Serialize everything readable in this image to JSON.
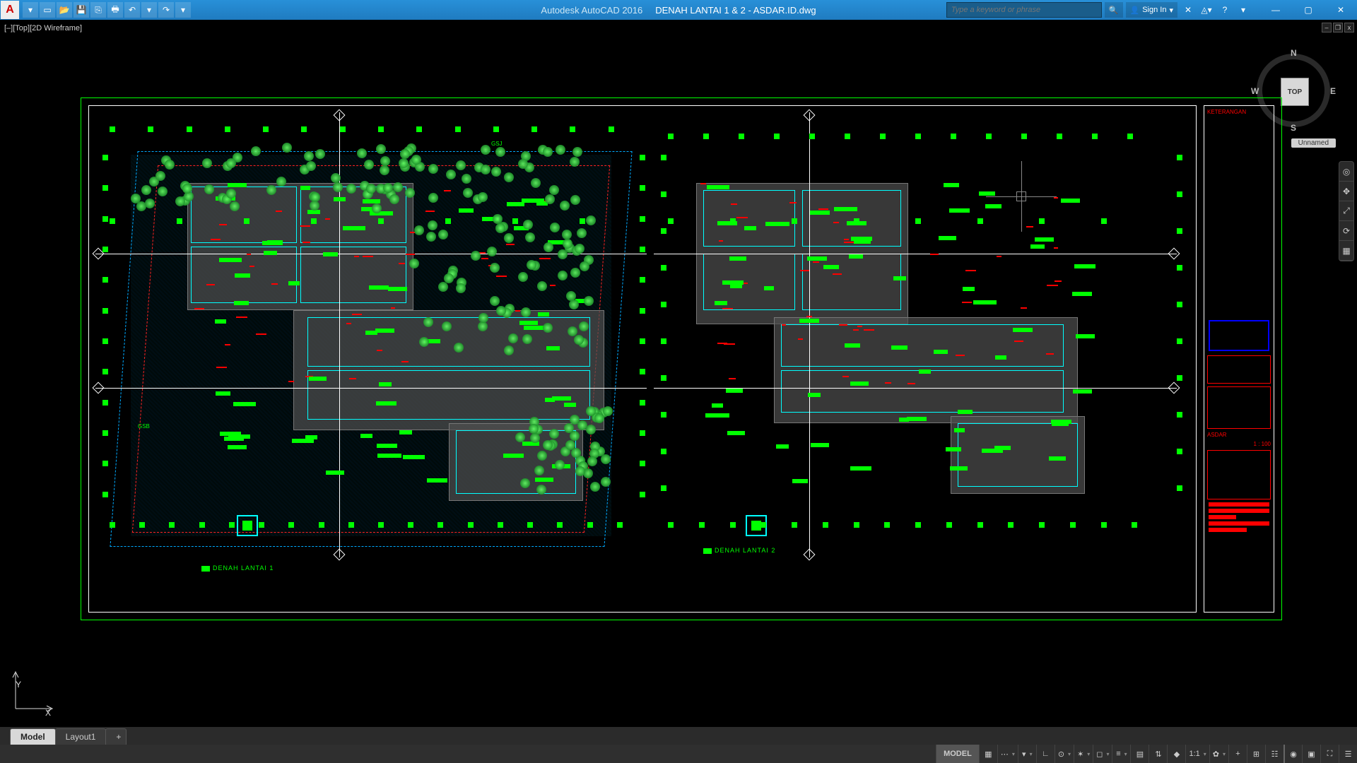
{
  "title": {
    "app": "Autodesk AutoCAD 2016",
    "file": "DENAH LANTAI 1 & 2 - ASDAR.ID.dwg"
  },
  "search": {
    "placeholder": "Type a keyword or phrase"
  },
  "signin": {
    "label": "Sign In"
  },
  "viewport_label": "[–][Top][2D Wireframe]",
  "viewcube": {
    "face": "TOP",
    "n": "N",
    "s": "S",
    "e": "E",
    "w": "W",
    "tag": "Unnamed"
  },
  "ucs": {
    "x": "X",
    "y": "Y"
  },
  "plans": {
    "left": "DENAH LANTAI 1",
    "right": "DENAH LANTAI 2"
  },
  "titleblock": {
    "head": "KETERANGAN",
    "scale": "1 : 100",
    "proj": "ASDAR"
  },
  "gsb": {
    "top": "GSJ",
    "side": "GSB"
  },
  "tabs": {
    "model": "Model",
    "layout1": "Layout1",
    "add": "+"
  },
  "status": {
    "model": "MODEL",
    "scale": "1:1"
  }
}
